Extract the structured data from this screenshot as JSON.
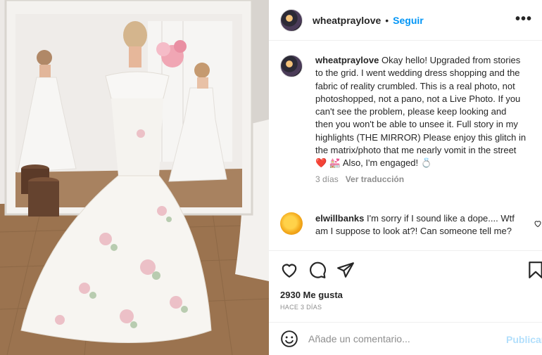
{
  "post": {
    "username": "wheatpraylove",
    "separator": "•",
    "follow_label": "Seguir",
    "more_label": "•••",
    "photo_description_icon": "wedding-dress-mirror-photo"
  },
  "caption": {
    "username": "wheatpraylove",
    "text": "Okay hello! Upgraded from stories to the grid. I went wedding dress shopping and the fabric of reality crumbled. This is a real photo, not photoshopped, not a pano, not a Live Photo. If you can't see the problem, please keep looking and then you won't be able to unsee it. Full story in my highlights (THE MIRROR) Please enjoy this glitch in the matrix/photo that me nearly vomit in the street",
    "emoji_line": "❤️ 💒 Also, I'm engaged! 💍",
    "age": "3 días",
    "translate_label": "Ver traducción"
  },
  "comment": {
    "username": "elwillbanks",
    "text": "I'm sorry if I sound like a dope.... Wtf am I suppose to look at?! Can someone tell me?"
  },
  "actions": {
    "icons": [
      "heart-icon",
      "comment-icon",
      "share-icon",
      "bookmark-icon"
    ]
  },
  "likes_label": "2930 Me gusta",
  "date_label": "HACE 3 DÍAS",
  "add_comment": {
    "placeholder": "Añade un comentario...",
    "post_label": "Publicar"
  },
  "colors": {
    "accent": "#0095f6",
    "post_disabled": "#b2dffc",
    "text": "#262626",
    "muted": "#8e8e8e"
  }
}
